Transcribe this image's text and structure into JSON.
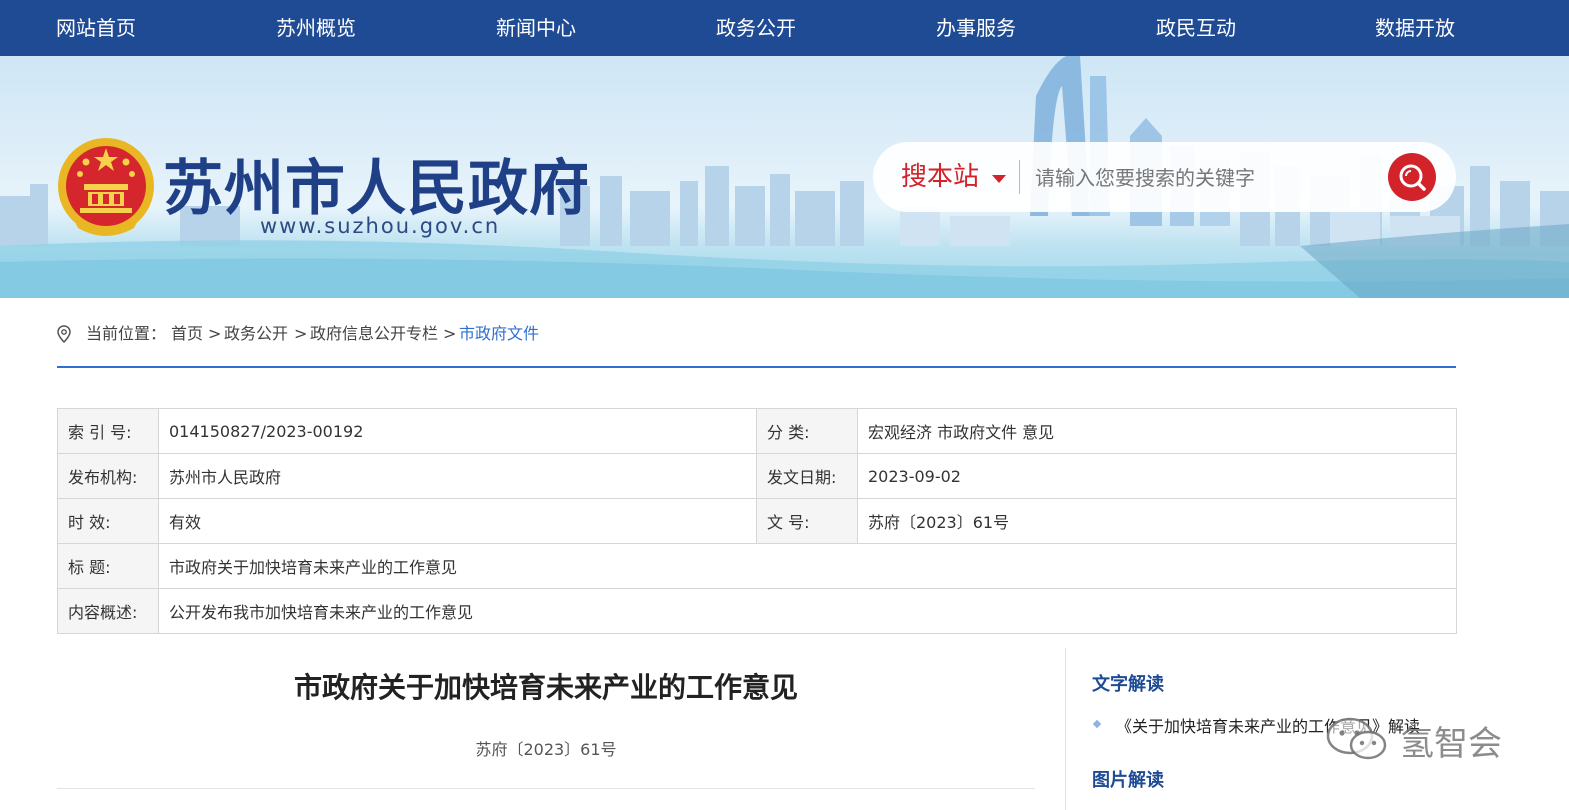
{
  "nav": {
    "items": [
      "网站首页",
      "苏州概览",
      "新闻中心",
      "政务公开",
      "办事服务",
      "政民互动",
      "数据开放"
    ]
  },
  "header": {
    "site_title": "苏州市人民政府",
    "site_url": "www.suzhou.gov.cn"
  },
  "search": {
    "scope_label": "搜本站",
    "placeholder": "请输入您要搜索的关键字"
  },
  "breadcrumb": {
    "prefix": "当前位置：",
    "items": [
      "首页",
      "政务公开",
      "政府信息公开专栏",
      "市政府文件"
    ],
    "separator": ">"
  },
  "info_table": {
    "index_label": "索 引 号:",
    "index_value": "014150827/2023-00192",
    "category_label": "分        类:",
    "category_value": "宏观经济 市政府文件 意见",
    "publisher_label": "发布机构:",
    "publisher_value": "苏州市人民政府",
    "date_label": "发文日期:",
    "date_value": "2023-09-02",
    "validity_label": "时        效:",
    "validity_value": "有效",
    "docno_label": "文        号:",
    "docno_value": "苏府〔2023〕61号",
    "title_label": "标        题:",
    "title_value": "市政府关于加快培育未来产业的工作意见",
    "summary_label": "内容概述:",
    "summary_value": "公开发布我市加快培育未来产业的工作意见"
  },
  "article": {
    "title": "市政府关于加快培育未来产业的工作意见",
    "doc_no": "苏府〔2023〕61号"
  },
  "sidebar": {
    "text_reading_heading": "文字解读",
    "text_reading_link": "《关于加快培育未来产业的工作意见》解读",
    "image_reading_heading": "图片解读"
  },
  "watermark": {
    "text": "氢智会"
  },
  "colors": {
    "nav_bg": "#1f4b94",
    "accent_blue": "#2f6fd3",
    "accent_red": "#d2232a"
  },
  "icons": [
    "location-pin-icon",
    "search-icon",
    "chevron-down-icon",
    "national-emblem-icon",
    "wechat-icon"
  ]
}
